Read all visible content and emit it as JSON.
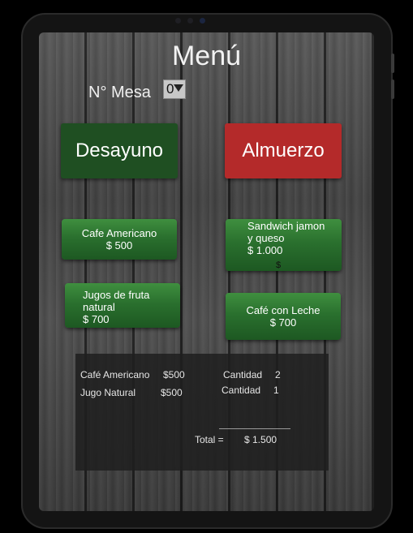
{
  "title": "Menú",
  "mesa": {
    "label": "N° Mesa",
    "selected": "0"
  },
  "categories": {
    "desayuno": "Desayuno",
    "almuerzo": "Almuerzo"
  },
  "items": {
    "cafe_americano": {
      "name": "Cafe Americano",
      "price": "$ 500"
    },
    "sandwich": {
      "name_line1": "Sandwich jamon",
      "name_line2": "y queso",
      "price": "$ 1.000",
      "stray": "$"
    },
    "jugos": {
      "name_line1": "Jugos de fruta",
      "name_line2": "natural",
      "price": "$ 700"
    },
    "cafe_leche": {
      "name": "Café con Leche",
      "price": "$ 700"
    }
  },
  "summary": {
    "rows": [
      {
        "item": "Café Americano",
        "price": "$500",
        "qty_label": "Cantidad",
        "qty": "2"
      },
      {
        "item": "Jugo Natural",
        "price": "$500",
        "qty_label": "Cantidad",
        "qty": "1"
      }
    ],
    "total_label": "Total =",
    "total_value": "$ 1.500"
  },
  "colors": {
    "desayuno": "#1f4f22",
    "almuerzo": "#b42a2a",
    "item_green": "#2a702e"
  }
}
